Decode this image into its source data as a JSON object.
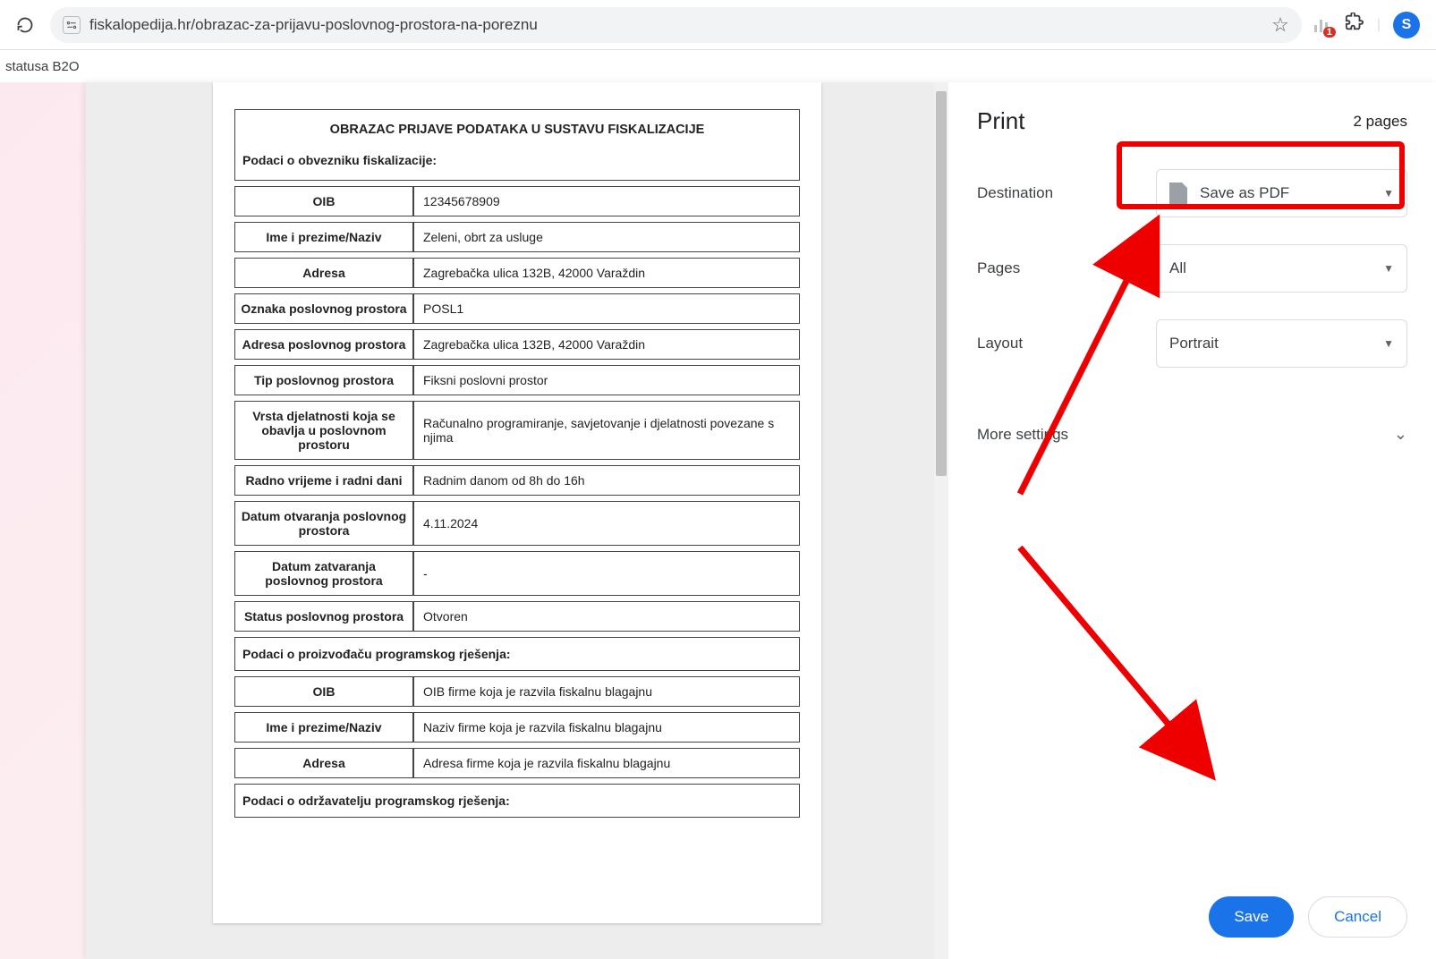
{
  "browser": {
    "url": "fiskalopedija.hr/obrazac-za-prijavu-poslovnog-prostora-na-poreznu",
    "bookmark_fragment": "statusa B2O",
    "ext_badge": "1",
    "profile_initial": "S"
  },
  "form": {
    "title": "OBRAZAC PRIJAVE PODATAKA U SUSTAVU FISKALIZACIJE",
    "section1": "Podaci o obvezniku fiskalizacije:",
    "rows1": [
      {
        "label": "OIB",
        "value": "12345678909"
      },
      {
        "label": "Ime i prezime/Naziv",
        "value": "Zeleni, obrt za usluge"
      },
      {
        "label": "Adresa",
        "value": "Zagrebačka ulica 132B, 42000 Varaždin"
      },
      {
        "label": "Oznaka poslovnog prostora",
        "value": "POSL1"
      },
      {
        "label": "Adresa poslovnog prostora",
        "value": "Zagrebačka ulica 132B, 42000 Varaždin"
      },
      {
        "label": "Tip poslovnog prostora",
        "value": "Fiksni poslovni prostor"
      },
      {
        "label": "Vrsta djelatnosti koja se obavlja u poslovnom prostoru",
        "value": "Računalno programiranje, savjetovanje i djelatnosti povezane s njima"
      },
      {
        "label": "Radno vrijeme i radni dani",
        "value": "Radnim danom od 8h do 16h"
      },
      {
        "label": "Datum otvaranja poslovnog prostora",
        "value": "4.11.2024"
      },
      {
        "label": "Datum zatvaranja poslovnog prostora",
        "value": "-"
      },
      {
        "label": "Status poslovnog prostora",
        "value": "Otvoren"
      }
    ],
    "section2": "Podaci o proizvođaču programskog rješenja:",
    "rows2": [
      {
        "label": "OIB",
        "value": "OIB firme koja je razvila fiskalnu blagajnu"
      },
      {
        "label": "Ime i prezime/Naziv",
        "value": "Naziv firme koja je razvila fiskalnu blagajnu"
      },
      {
        "label": "Adresa",
        "value": "Adresa firme koja je razvila fiskalnu blagajnu"
      }
    ],
    "section3": "Podaci o održavatelju programskog rješenja:"
  },
  "print": {
    "title": "Print",
    "page_count": "2 pages",
    "destination_label": "Destination",
    "destination_value": "Save as PDF",
    "pages_label": "Pages",
    "pages_value": "All",
    "layout_label": "Layout",
    "layout_value": "Portrait",
    "more": "More settings",
    "save": "Save",
    "cancel": "Cancel"
  }
}
